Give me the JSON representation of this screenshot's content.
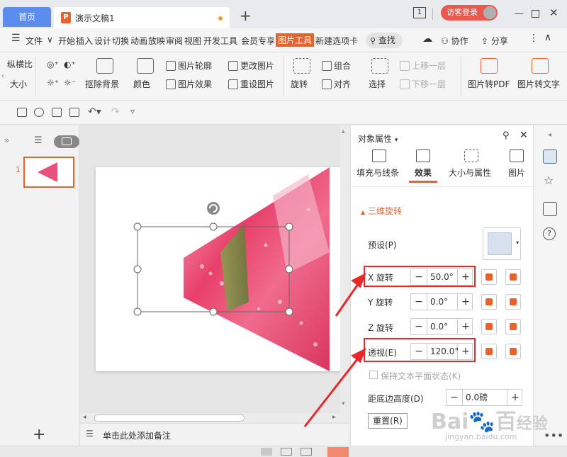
{
  "titlebar": {
    "home_tab": "首页",
    "doc_tab": "演示文稿1",
    "page_indicator": "1",
    "login": "访客登录"
  },
  "menubar": {
    "file": "文件",
    "items": [
      "开始",
      "插入",
      "设计",
      "切换",
      "动画",
      "放映",
      "审阅",
      "视图",
      "开发工具",
      "会员专享",
      "图片工具",
      "新建选项卡"
    ],
    "active": "图片工具",
    "search": "查找",
    "collab": "协作",
    "share": "分享"
  },
  "ribbon": {
    "aspect_ratio": "纵横比",
    "size": "大小",
    "remove_bg": "抠除背景",
    "color": "颜色",
    "outline": "图片轮廓",
    "effect": "图片效果",
    "change_pic": "更改图片",
    "reset_pic": "重设图片",
    "rotate": "旋转",
    "group": "组合",
    "align": "对齐",
    "select": "选择",
    "bring_forward": "上移一层",
    "send_backward": "下移一层",
    "to_pdf": "图片转PDF",
    "to_text": "图片转文字"
  },
  "thumbs": {
    "slide_num": "1"
  },
  "notes": {
    "placeholder": "单击此处添加备注"
  },
  "props": {
    "title": "对象属性",
    "tabs": [
      "填充与线条",
      "效果",
      "大小与属性",
      "图片"
    ],
    "active_tab": "效果",
    "section": "三维旋转",
    "preset_label": "预设(P)",
    "rows": [
      {
        "label": "X 旋转",
        "value": "50.0°"
      },
      {
        "label": "Y 旋转",
        "value": "0.0°"
      },
      {
        "label": "Z 旋转",
        "value": "0.0°"
      },
      {
        "label": "透视(E)",
        "value": "120.0°"
      }
    ],
    "keep_flat": "保持文本平面状态(K)",
    "distance_label": "距底边高度(D)",
    "distance_value": "0.0磅",
    "reset": "重置(R)"
  },
  "watermark": {
    "logo": "Bai",
    "logo2": "百",
    "logo3": "经验",
    "url": "jingyan.baidu.com"
  },
  "colors": {
    "accent": "#e9622c",
    "highlight": "#e8282b",
    "home_tab": "#5b8def"
  }
}
